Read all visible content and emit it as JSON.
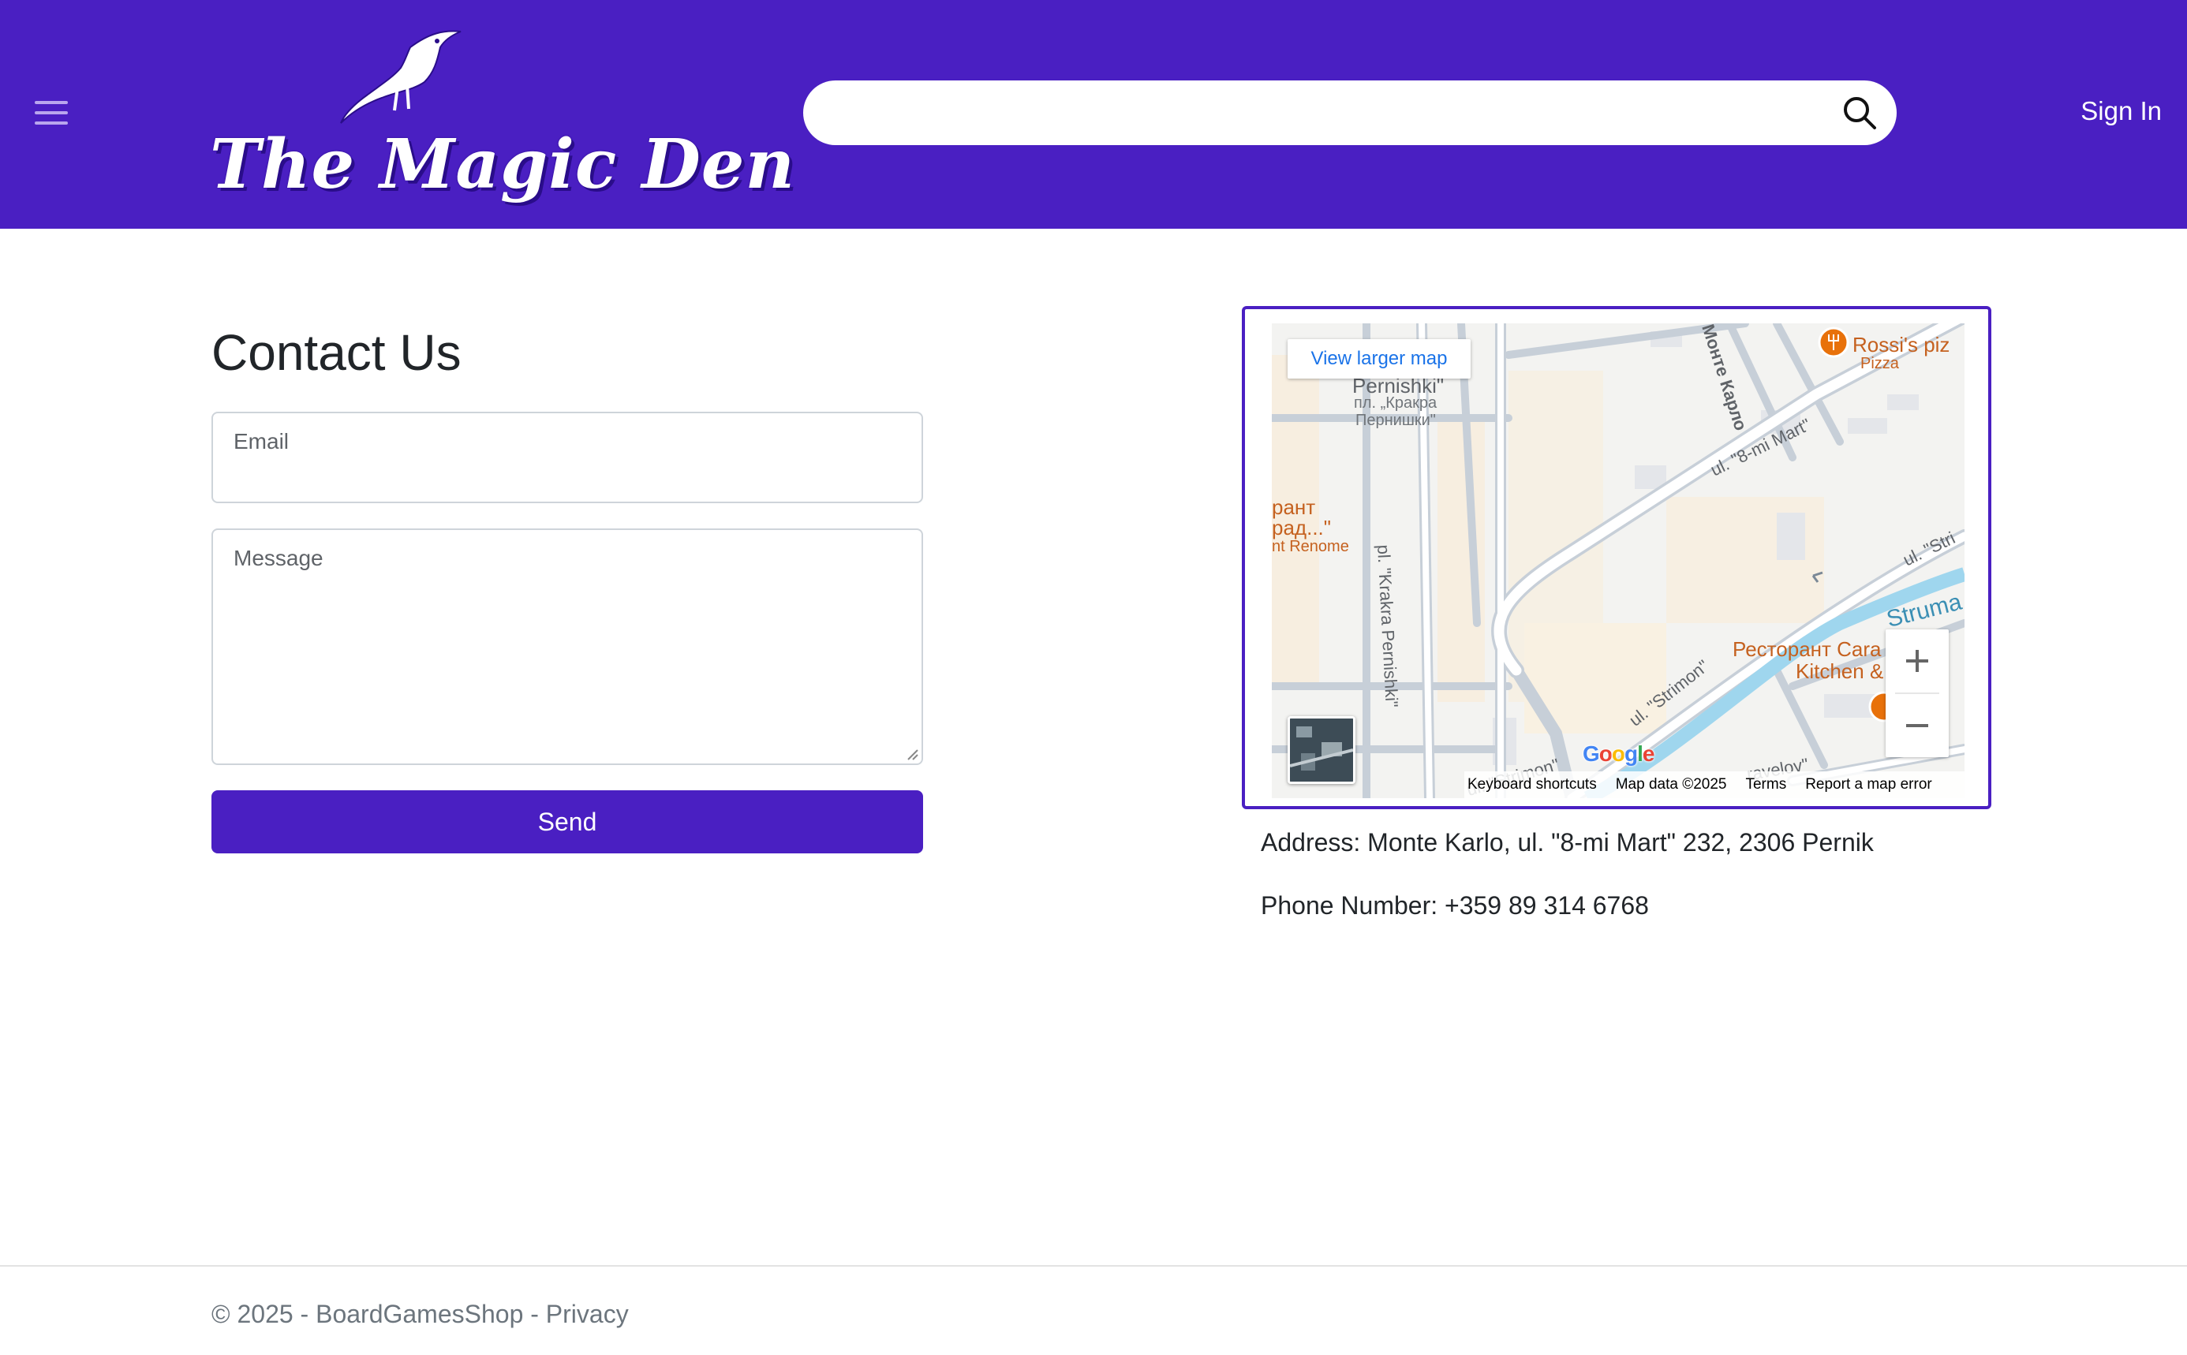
{
  "header": {
    "logo_text": "The Magic Den",
    "search": {
      "value": "",
      "placeholder": "",
      "icon": "search-icon"
    },
    "menu_icon": "hamburger-menu-icon",
    "sign_in_label": "Sign In"
  },
  "contact": {
    "title": "Contact Us",
    "email_label": "Email",
    "email_value": "",
    "message_label": "Message",
    "message_value": "",
    "send_label": "Send"
  },
  "map": {
    "view_larger_label": "View larger map",
    "labels": {
      "pernishki": "Pernishki\"",
      "square_bg_1": "пл. „Кракра",
      "square_bg_2": "Пернишки\"",
      "restaurant_1": "рант",
      "restaurant_2": "рад...\"",
      "restaurant_3": "nt Renome",
      "krakra_street": "pl. \"Krakra Pernishki\"",
      "monte_karlo": "Монте Карло",
      "mart_street": "ul. \"8-mi Mart\"",
      "stri_street": "ul. \"Stri",
      "struma": "Struma",
      "strimon_1": "ul. \"Strimon\"",
      "strimon_2": "ul. \"Strimon\"",
      "karavelov": "ravelov\"",
      "rossis": "Rossi's piz",
      "pizza": "Pizza",
      "restaurant_cara_1": "Ресторант Cara",
      "restaurant_cara_2": "Kitchen &"
    },
    "google_logo": "Google",
    "footer": {
      "shortcuts": "Keyboard shortcuts",
      "map_data": "Map data ©2025",
      "terms": "Terms",
      "report": "Report a map error"
    },
    "colors": {
      "water": "#9fd6ee",
      "poi": "#e8710a",
      "road": "#ffffff",
      "road_edge": "#c7cfd8"
    }
  },
  "info": {
    "address": "Address: Monte Karlo, ul. \"8-mi Mart\" 232, 2306 Pernik",
    "phone": "Phone Number: +359 89 314 6768"
  },
  "footer": {
    "copyright": "© 2025 - BoardGamesShop - ",
    "privacy_label": "Privacy"
  },
  "colors": {
    "brand": "#4a1fc2",
    "text": "#212529",
    "muted": "#6c757d"
  }
}
